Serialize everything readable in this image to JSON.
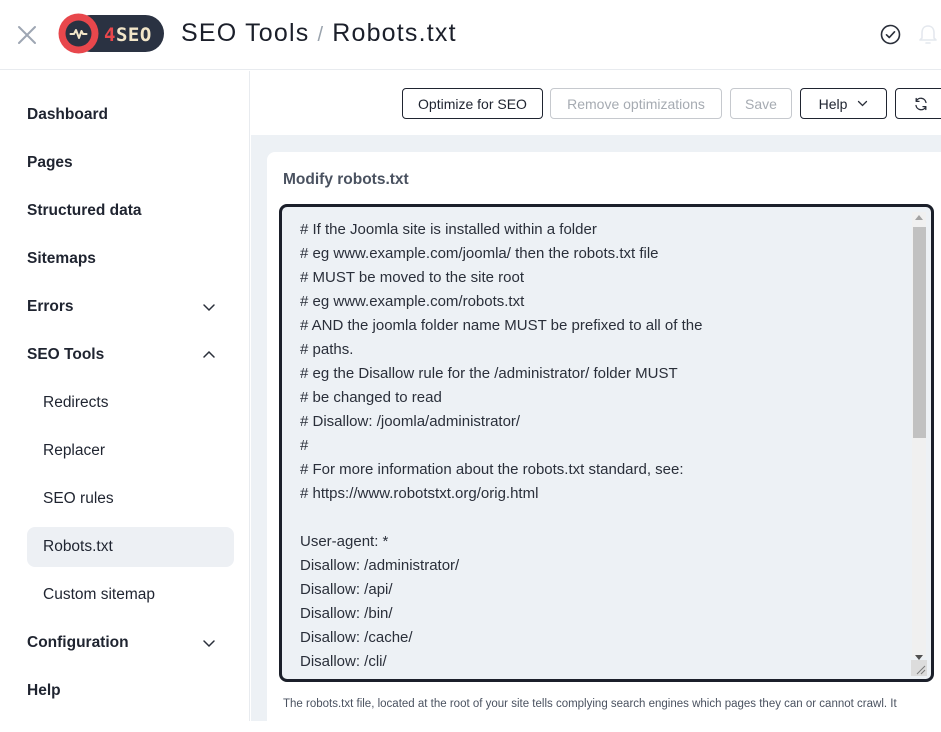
{
  "header": {
    "logo_text": "4SEO",
    "breadcrumb": {
      "section": "SEO Tools",
      "separator": "/",
      "page": "Robots.txt"
    },
    "icons": {
      "close": "close-icon",
      "status": "check-circle-icon",
      "notifications": "bell-icon"
    }
  },
  "sidebar": {
    "items": [
      {
        "label": "Dashboard"
      },
      {
        "label": "Pages"
      },
      {
        "label": "Structured data"
      },
      {
        "label": "Sitemaps"
      },
      {
        "label": "Errors",
        "expandable": true,
        "expanded": false
      },
      {
        "label": "SEO Tools",
        "expandable": true,
        "expanded": true
      },
      {
        "label": "Configuration",
        "expandable": true,
        "expanded": false
      },
      {
        "label": "Help"
      }
    ],
    "sub_items": [
      {
        "label": "Redirects"
      },
      {
        "label": "Replacer"
      },
      {
        "label": "SEO rules"
      },
      {
        "label": "Robots.txt",
        "active": true
      },
      {
        "label": "Custom sitemap"
      }
    ]
  },
  "toolbar": {
    "optimize_label": "Optimize for SEO",
    "remove_label": "Remove optimizations",
    "save_label": "Save",
    "help_label": "Help",
    "refresh_icon": "refresh-icon"
  },
  "card": {
    "title": "Modify robots.txt",
    "editor_content": "# If the Joomla site is installed within a folder\n# eg www.example.com/joomla/ then the robots.txt file\n# MUST be moved to the site root\n# eg www.example.com/robots.txt\n# AND the joomla folder name MUST be prefixed to all of the\n# paths.\n# eg the Disallow rule for the /administrator/ folder MUST\n# be changed to read\n# Disallow: /joomla/administrator/\n#\n# For more information about the robots.txt standard, see:\n# https://www.robotstxt.org/orig.html\n\nUser-agent: *\nDisallow: /administrator/\nDisallow: /api/\nDisallow: /bin/\nDisallow: /cache/\nDisallow: /cli/",
    "help_text": "The robots.txt file, located at the root of your site tells complying search engines which pages they can or cannot crawl. It"
  },
  "colors": {
    "logo_red": "#e8474c",
    "logo_dark": "#2a3242",
    "logo_text": "#f2e6c9",
    "panel_bg": "#edf1f5",
    "editor_border": "#1b1f2a"
  }
}
